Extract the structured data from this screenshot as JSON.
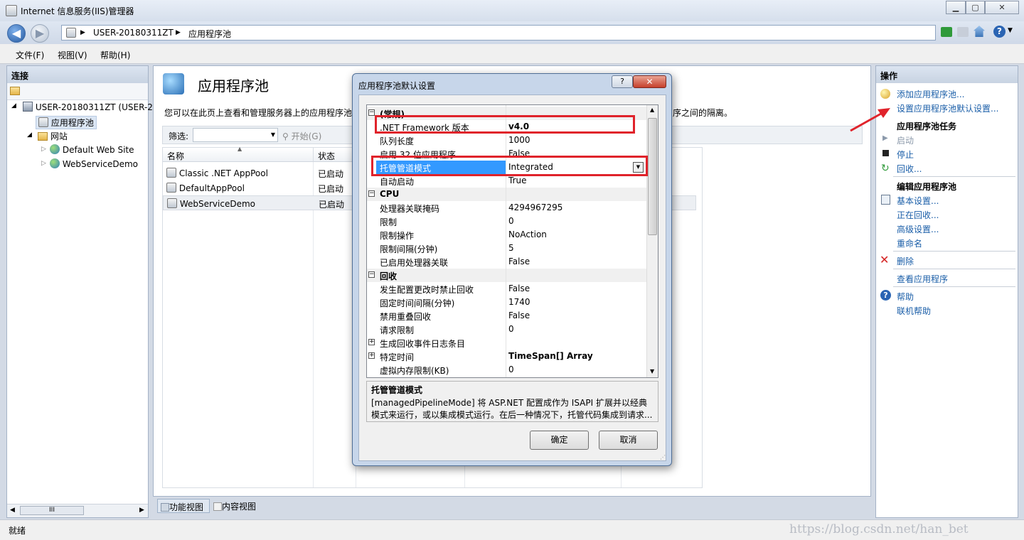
{
  "window": {
    "title": "Internet 信息服务(IIS)管理器"
  },
  "address": {
    "segments": [
      "USER-20180311ZT",
      "应用程序池"
    ]
  },
  "menu": [
    "文件(F)",
    "视图(V)",
    "帮助(H)"
  ],
  "connections": {
    "title": "连接",
    "tree": [
      {
        "label": "USER-20180311ZT (USER-2",
        "level": 0
      },
      {
        "label": "应用程序池",
        "level": 1
      },
      {
        "label": "网站",
        "level": 1
      },
      {
        "label": "Default Web Site",
        "level": 2
      },
      {
        "label": "WebServiceDemo",
        "level": 2
      }
    ],
    "hscroll_label": "III"
  },
  "main": {
    "title": "应用程序池",
    "description_left": "您可以在此页上查看和管理服务器上的应用程序池",
    "description_right": "序之间的隔离。",
    "filter_label": "筛选:",
    "go_label": "开始(G)",
    "columns": [
      "名称",
      "状态"
    ],
    "rows": [
      {
        "name": "Classic .NET AppPool",
        "status": "已启动"
      },
      {
        "name": "DefaultAppPool",
        "status": "已启动"
      },
      {
        "name": "WebServiceDemo",
        "status": "已启动"
      }
    ],
    "view_tabs": [
      "功能视图",
      "内容视图"
    ]
  },
  "actions": {
    "title": "操作",
    "items": [
      "添加应用程序池...",
      "设置应用程序池默认设置..."
    ],
    "section_tasks": "应用程序池任务",
    "tasks": [
      "启动",
      "停止",
      "回收..."
    ],
    "section_edit": "编辑应用程序池",
    "edit": [
      "基本设置...",
      "正在回收...",
      "高级设置...",
      "重命名"
    ],
    "delete": "删除",
    "view_apps": "查看应用程序",
    "help": "帮助",
    "online_help": "联机帮助"
  },
  "statusbar": {
    "text": "就绪",
    "watermark": "https://blog.csdn.net/han_bet"
  },
  "dialog": {
    "title": "应用程序池默认设置",
    "help_btn": "?",
    "properties": [
      {
        "name": "(常规)",
        "value": "",
        "category": true,
        "expand": "−"
      },
      {
        "name": ".NET Framework 版本",
        "value": "v4.0",
        "bold_value": true
      },
      {
        "name": "队列长度",
        "value": "1000"
      },
      {
        "name": "启用 32 位应用程序",
        "value": "False"
      },
      {
        "name": "托管管道模式",
        "value": "Integrated",
        "selected": true
      },
      {
        "name": "自动启动",
        "value": "True"
      },
      {
        "name": "CPU",
        "value": "",
        "category": true,
        "expand": "−"
      },
      {
        "name": "处理器关联掩码",
        "value": "4294967295"
      },
      {
        "name": "限制",
        "value": "0"
      },
      {
        "name": "限制操作",
        "value": "NoAction"
      },
      {
        "name": "限制间隔(分钟)",
        "value": "5"
      },
      {
        "name": "已启用处理器关联",
        "value": "False"
      },
      {
        "name": "回收",
        "value": "",
        "category": true,
        "expand": "−"
      },
      {
        "name": "发生配置更改时禁止回收",
        "value": "False"
      },
      {
        "name": "固定时间间隔(分钟)",
        "value": "1740"
      },
      {
        "name": "禁用重叠回收",
        "value": "False"
      },
      {
        "name": "请求限制",
        "value": "0"
      },
      {
        "name": "生成回收事件日志条目",
        "value": "",
        "expand": "+"
      },
      {
        "name": "特定时间",
        "value": "TimeSpan[] Array",
        "bold_value": true,
        "expand": "+"
      },
      {
        "name": "虚拟内存限制(KB)",
        "value": "0"
      }
    ],
    "desc_title": "托管管道模式",
    "desc_line1": "[managedPipelineMode] 将 ASP.NET 配置成作为 ISAPI 扩展并以经典",
    "desc_line2": "模式来运行，或以集成模式运行。在后一种情况下，托管代码集成到请求...",
    "ok": "确定",
    "cancel": "取消"
  },
  "colors": {
    "highlight": "#3399ff",
    "callout": "#e0232b",
    "link": "#1a5ea8"
  }
}
